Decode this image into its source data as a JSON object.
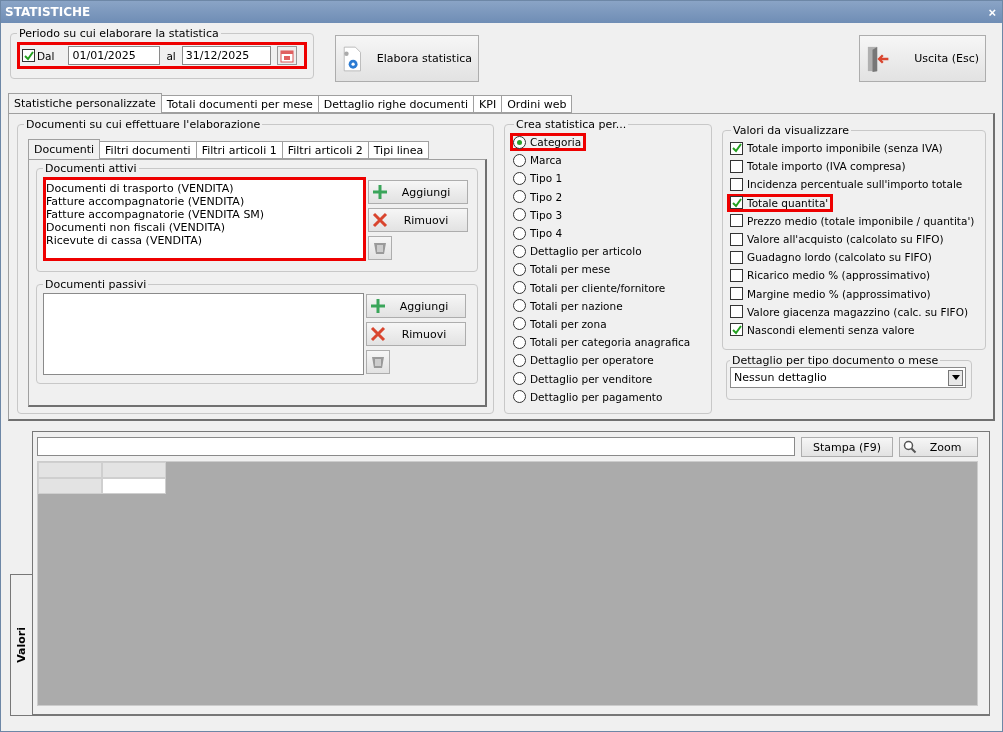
{
  "window": {
    "title": "STATISTICHE",
    "close": "×"
  },
  "period": {
    "legend": "Periodo su cui elaborare la statistica",
    "highlighted": true,
    "enabled": {
      "label": "Dal",
      "checked": true
    },
    "from": "01/01/2025",
    "to_label": "al",
    "to": "31/12/2025"
  },
  "buttons": {
    "process": "Elabora statistica",
    "exit": "Uscita (Esc)"
  },
  "tabs": [
    {
      "label": "Statistiche personalizzate",
      "selected": true
    },
    {
      "label": "Totali documenti per mese",
      "selected": false
    },
    {
      "label": "Dettaglio righe documenti",
      "selected": false
    },
    {
      "label": "KPI",
      "selected": false
    },
    {
      "label": "Ordini web",
      "selected": false
    }
  ],
  "documents": {
    "legend": "Documenti su cui effettuare l'elaborazione",
    "tabs": [
      {
        "label": "Documenti",
        "selected": true
      },
      {
        "label": "Filtri documenti",
        "selected": false
      },
      {
        "label": "Filtri articoli 1",
        "selected": false
      },
      {
        "label": "Filtri articoli 2",
        "selected": false
      },
      {
        "label": "Tipi linea",
        "selected": false
      }
    ],
    "groups": [
      {
        "legend": "Documenti attivi",
        "highlighted": true,
        "items": [
          "Documenti di trasporto (VENDITA)",
          "Fatture accompagnatorie (VENDITA)",
          "Fatture accompagnatorie (VENDITA SM)",
          "Documenti non fiscali (VENDITA)",
          "Ricevute di cassa (VENDITA)"
        ],
        "add": "Aggiungi",
        "remove": "Rimuovi"
      },
      {
        "legend": "Documenti passivi",
        "highlighted": false,
        "add": "Aggiungi",
        "remove": "Rimuovi"
      }
    ]
  },
  "group_by": {
    "legend": "Crea statistica per...",
    "options": [
      {
        "label": "Categoria",
        "selected": true,
        "highlighted": true
      },
      {
        "label": "Marca",
        "selected": false,
        "highlighted": false
      },
      {
        "label": "Tipo 1",
        "selected": false,
        "highlighted": false
      },
      {
        "label": "Tipo 2",
        "selected": false,
        "highlighted": false
      },
      {
        "label": "Tipo 3",
        "selected": false,
        "highlighted": false
      },
      {
        "label": "Tipo 4",
        "selected": false,
        "highlighted": false
      },
      {
        "label": "Dettaglio per articolo",
        "selected": false,
        "highlighted": false
      },
      {
        "label": "Totali per mese",
        "selected": false,
        "highlighted": false
      },
      {
        "label": "Totali per cliente/fornitore",
        "selected": false,
        "highlighted": false
      },
      {
        "label": "Totali per nazione",
        "selected": false,
        "highlighted": false
      },
      {
        "label": "Totali per zona",
        "selected": false,
        "highlighted": false
      },
      {
        "label": "Totali per categoria anagrafica",
        "selected": false,
        "highlighted": false
      },
      {
        "label": "Dettaglio per operatore",
        "selected": false,
        "highlighted": false
      },
      {
        "label": "Dettaglio per venditore",
        "selected": false,
        "highlighted": false
      },
      {
        "label": "Dettaglio per pagamento",
        "selected": false,
        "highlighted": false
      }
    ]
  },
  "values": {
    "legend": "Valori da visualizzare",
    "options": [
      {
        "label": "Totale importo imponibile (senza IVA)",
        "checked": true,
        "highlighted": false
      },
      {
        "label": "Totale importo (IVA compresa)",
        "checked": false,
        "highlighted": false
      },
      {
        "label": "Incidenza percentuale sull'importo totale",
        "checked": false,
        "highlighted": false
      },
      {
        "label": "Totale quantita'",
        "checked": true,
        "highlighted": true
      },
      {
        "label": "Prezzo medio (totale imponibile / quantita')",
        "checked": false,
        "highlighted": false
      },
      {
        "label": "Valore all'acquisto (calcolato su FIFO)",
        "checked": false,
        "highlighted": false
      },
      {
        "label": "Guadagno lordo (calcolato su FIFO)",
        "checked": false,
        "highlighted": false
      },
      {
        "label": "Ricarico medio % (approssimativo)",
        "checked": false,
        "highlighted": false
      },
      {
        "label": "Margine medio % (approssimativo)",
        "checked": false,
        "highlighted": false
      },
      {
        "label": "Valore giacenza magazzino (calc. su FIFO)",
        "checked": false,
        "highlighted": false
      },
      {
        "label": "Nascondi elementi senza valore",
        "checked": true,
        "highlighted": false
      }
    ]
  },
  "detail": {
    "legend": "Dettaglio per tipo documento o mese",
    "value": "Nessun dettaglio"
  },
  "results": {
    "side_tab": "Valori",
    "print": "Stampa (F9)",
    "zoom": "Zoom"
  }
}
